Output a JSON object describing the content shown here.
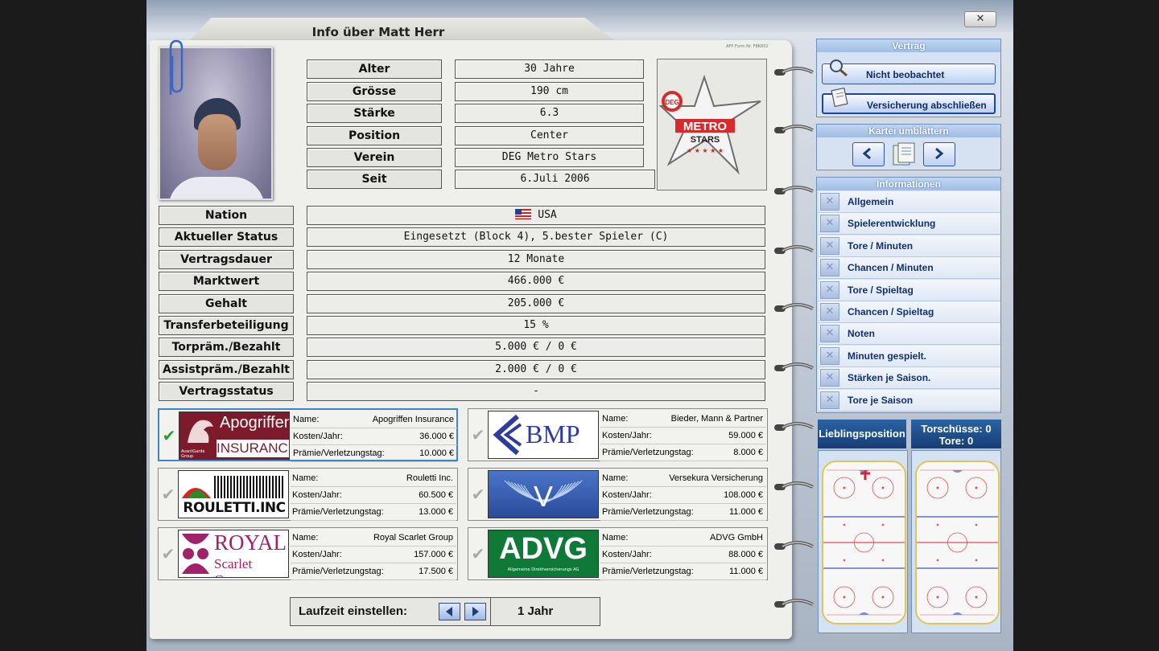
{
  "window": {
    "close_label": "✕"
  },
  "title": "Info über Matt Herr",
  "form_nr": "AFP Form.Nr. FBK802",
  "club_logo": {
    "top": "DEG",
    "name": "METRO",
    "sub": "STARS"
  },
  "top_fields": [
    {
      "label": "Alter",
      "value": "30 Jahre"
    },
    {
      "label": "Grösse",
      "value": "190 cm"
    },
    {
      "label": "Stärke",
      "value": "6.3"
    },
    {
      "label": "Position",
      "value": "Center"
    },
    {
      "label": "Verein",
      "value": "DEG Metro Stars"
    },
    {
      "label": "Seit",
      "value": "6.Juli 2006"
    }
  ],
  "fields": [
    {
      "label": "Nation",
      "value": "USA"
    },
    {
      "label": "Aktueller Status",
      "value": "Eingesetzt (Block 4), 5.bester Spieler (C)"
    },
    {
      "label": "Vertragsdauer",
      "value": "12 Monate"
    },
    {
      "label": "Marktwert",
      "value": "466.000 €"
    },
    {
      "label": "Gehalt",
      "value": "205.000 €"
    },
    {
      "label": "Transferbeteiligung",
      "value": "15 %"
    },
    {
      "label": "Torpräm./Bezahlt",
      "value": "5.000 € / 0 €"
    },
    {
      "label": "Assistpräm./Bezahlt",
      "value": "2.000 € / 0 €"
    },
    {
      "label": "Vertragsstatus",
      "value": "-"
    }
  ],
  "insurance_keys": {
    "name": "Name:",
    "cost": "Kosten/Jahr:",
    "premium": "Prämie/Verletzungstag:"
  },
  "insurances": [
    {
      "name": "Apogriffen Insurance",
      "cost": "36.000 €",
      "premium": "10.000 €",
      "logo": {
        "line1": "Apogriffen",
        "line2": "INSURANCE",
        "small": "AvantGarde Group"
      }
    },
    {
      "name": "Bieder, Mann & Partner",
      "cost": "59.000 €",
      "premium": "8.000 €",
      "logo": {
        "line1": "BMP"
      }
    },
    {
      "name": "Rouletti Inc.",
      "cost": "60.500 €",
      "premium": "13.000 €",
      "logo": {
        "line1": "ROULETTI.INC"
      }
    },
    {
      "name": "Versekura Versicherung",
      "cost": "108.000 €",
      "premium": "11.000 €",
      "logo": {
        "line1": "V"
      }
    },
    {
      "name": "Royal Scarlet Group",
      "cost": "157.000 €",
      "premium": "17.500 €",
      "logo": {
        "line1": "ROYAL",
        "line2": "Scarlet Group"
      }
    },
    {
      "name": "ADVG GmbH",
      "cost": "88.000 €",
      "premium": "11.000 €",
      "logo": {
        "line1": "ADVG",
        "line2": "Allgemeine Direktversicherungs AG"
      }
    }
  ],
  "laufzeit": {
    "label": "Laufzeit einstellen:",
    "value": "1 Jahr"
  },
  "side": {
    "vertrag": {
      "title": "Vertrag",
      "btn1": "Nicht beobachtet",
      "btn2": "Versicherung abschließen"
    },
    "kartei": {
      "title": "Kartei umblättern"
    },
    "informationen": {
      "title": "Informationen",
      "items": [
        "Allgemein",
        "Spielerentwicklung",
        "Tore / Minuten",
        "Chancen / Minuten",
        "Tore / Spieltag",
        "Chancen / Spieltag",
        "Noten",
        "Minuten gespielt.",
        "Stärken je Saison.",
        "Tore je Saison"
      ]
    }
  },
  "rinks": {
    "left_title": "Lieblingsposition",
    "right_title_1": "Torschüsse: 0",
    "right_title_2": "Tore: 0"
  }
}
